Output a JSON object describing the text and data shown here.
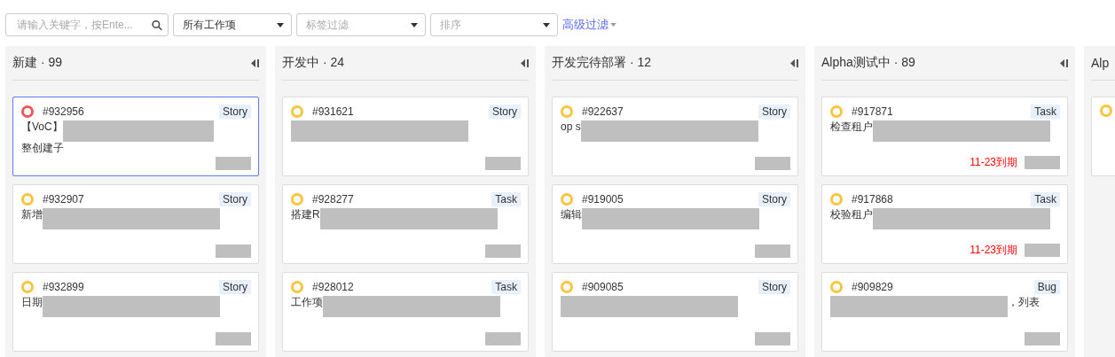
{
  "toolbar": {
    "search": {
      "placeholder": "请输入关键字，按Ente..."
    },
    "filters": [
      {
        "value": "所有工作项",
        "placeholder": false
      },
      {
        "value": "标签过滤",
        "placeholder": true
      },
      {
        "value": "排序",
        "placeholder": true
      }
    ],
    "advanced": "高级过滤"
  },
  "columns": [
    {
      "title": "新建 · 99",
      "cards": [
        {
          "id": "#932956",
          "type": "Story",
          "color": "#f0575a",
          "selected": true,
          "title": "【VoC】",
          "title2": "整创建子"
        },
        {
          "id": "#932907",
          "type": "Story",
          "color": "#fbc43f",
          "selected": false,
          "title": "新增"
        },
        {
          "id": "#932899",
          "type": "Story",
          "color": "#fbc43f",
          "selected": false,
          "title": "日期"
        }
      ]
    },
    {
      "title": "开发中 · 24",
      "cards": [
        {
          "id": "#931621",
          "type": "Story",
          "color": "#fbc43f",
          "selected": false
        },
        {
          "id": "#928277",
          "type": "Task",
          "color": "#fbc43f",
          "selected": false,
          "title": "搭建R"
        },
        {
          "id": "#928012",
          "type": "Task",
          "color": "#fbc43f",
          "selected": false,
          "title": "工作项"
        }
      ]
    },
    {
      "title": "开发完待部署 · 12",
      "cards": [
        {
          "id": "#922637",
          "type": "Story",
          "color": "#fbc43f",
          "selected": false,
          "title": "op s"
        },
        {
          "id": "#919005",
          "type": "Story",
          "color": "#fbc43f",
          "selected": false,
          "title": "编辑"
        },
        {
          "id": "#909085",
          "type": "Story",
          "color": "#fbc43f",
          "selected": false
        }
      ]
    },
    {
      "title": "Alpha测试中 · 89",
      "cards": [
        {
          "id": "#917871",
          "type": "Task",
          "color": "#fbc43f",
          "selected": false,
          "title": "检查租户",
          "due": "11-23到期"
        },
        {
          "id": "#917868",
          "type": "Task",
          "color": "#fbc43f",
          "selected": false,
          "title": "校验租户",
          "due": "11-23到期"
        },
        {
          "id": "#909829",
          "type": "Bug",
          "color": "#fbc43f",
          "selected": false,
          "title2": "，列表"
        }
      ]
    },
    {
      "title": "Alp",
      "cards": [
        {
          "color": "#fbc43f",
          "selected": false
        }
      ]
    }
  ]
}
